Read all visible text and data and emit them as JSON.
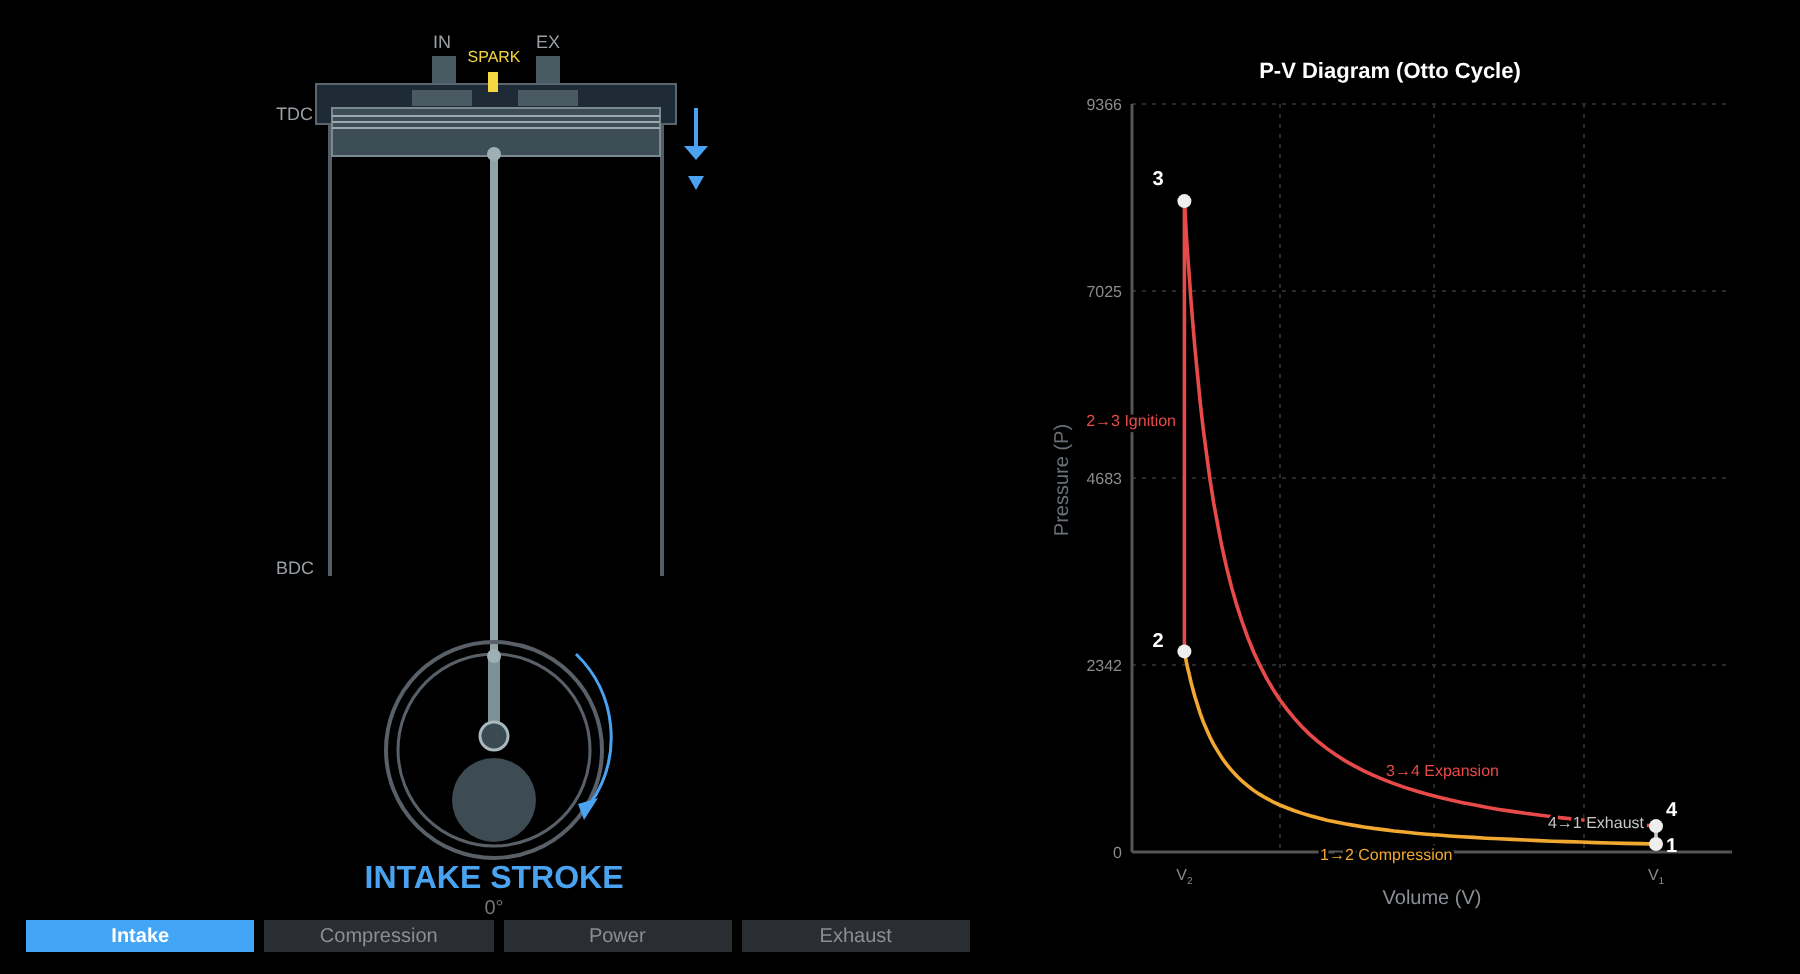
{
  "engine": {
    "intake_label": "IN",
    "spark_label": "SPARK",
    "exhaust_label": "EX",
    "tdc_label": "TDC",
    "bdc_label": "BDC"
  },
  "stroke": {
    "title": "INTAKE STROKE",
    "angle": "0°"
  },
  "tabs": [
    {
      "label": "Intake",
      "selected": true
    },
    {
      "label": "Compression",
      "selected": false
    },
    {
      "label": "Power",
      "selected": false
    },
    {
      "label": "Exhaust",
      "selected": false
    }
  ],
  "diagram": {
    "title": "P-V Diagram (Otto Cycle)",
    "y_axis_title": "Pressure (P)",
    "x_axis_title": "Volume (V)",
    "y_ticks": [
      "9366",
      "7025",
      "4683",
      "2342",
      "0"
    ],
    "x_ticks": [
      "V$_{2}$",
      "V$_{1}$"
    ],
    "processes": [
      {
        "label": "1→2 Compression",
        "color": "#f0a830"
      },
      {
        "label": "2→3 Ignition",
        "color": "#e84a4a"
      },
      {
        "label": "3→4 Expansion",
        "color": "#e84a4a"
      },
      {
        "label": "4→1 Exhaust",
        "color": "#c8c8c8"
      }
    ],
    "points": [
      {
        "label": "1"
      },
      {
        "label": "2"
      },
      {
        "label": "3"
      },
      {
        "label": "4"
      }
    ]
  }
}
